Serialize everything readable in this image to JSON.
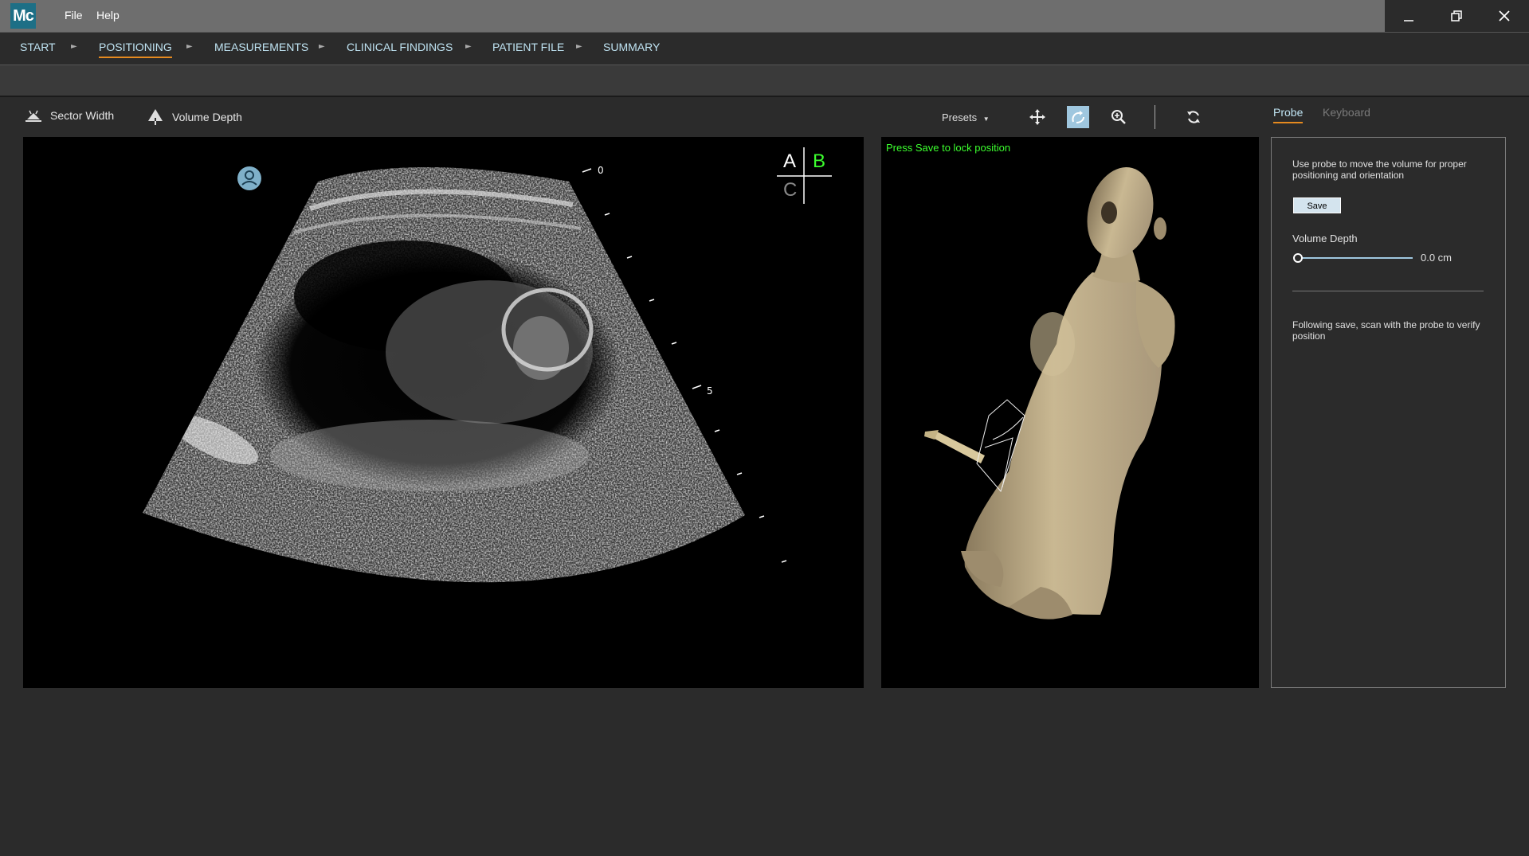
{
  "app": {
    "logo_text": "Mc"
  },
  "menu": {
    "file": "File",
    "help": "Help"
  },
  "breadcrumb": [
    {
      "label": "START"
    },
    {
      "label": "POSITIONING",
      "active": true
    },
    {
      "label": "MEASUREMENTS"
    },
    {
      "label": "CLINICAL FINDINGS"
    },
    {
      "label": "PATIENT FILE"
    },
    {
      "label": "SUMMARY"
    }
  ],
  "toolbar": {
    "sector_width": "Sector Width",
    "volume_depth": "Volume Depth",
    "presets": "Presets"
  },
  "ultrasound": {
    "depth_marks": {
      "top": "0",
      "mid": "5"
    },
    "planes": {
      "a": "A",
      "b": "B",
      "c": "C"
    },
    "active_plane": "B",
    "colors": {
      "active_plane": "#3cff2e",
      "plane": "#ffffff"
    }
  },
  "model_view": {
    "status": "Press Save to lock position"
  },
  "side_panel": {
    "tabs": {
      "probe": "Probe",
      "keyboard": "Keyboard"
    },
    "instructions": "Use probe to move the volume for proper positioning and orientation",
    "save_label": "Save",
    "volume_depth_label": "Volume Depth",
    "volume_depth_value": "0.0 cm",
    "volume_depth_level": 0,
    "footer_text": "Following save, scan with the probe to verify position"
  },
  "colors": {
    "accent": "#e58a1f",
    "nav_text": "#bfe3f2",
    "status_green": "#3cff2e"
  }
}
